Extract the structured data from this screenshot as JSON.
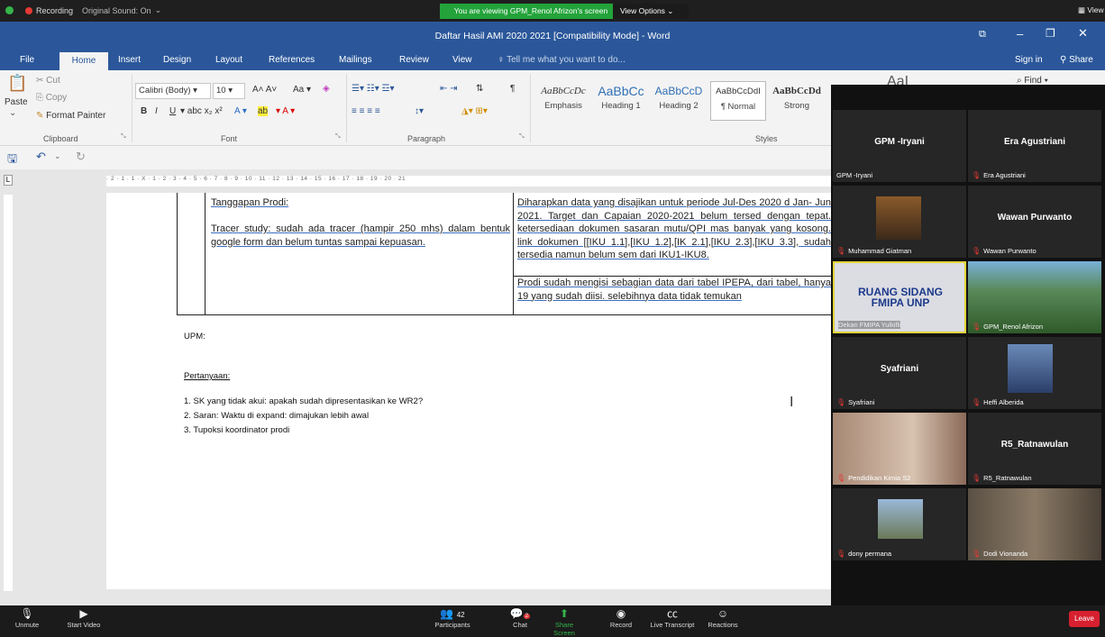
{
  "zoom": {
    "recording": "Recording",
    "original_sound": "Original Sound: On",
    "viewing_banner": "You are viewing GPM_Renol Afrizon's screen",
    "view_options": "View Options",
    "top_right_view": "View",
    "toolbar": {
      "unmute": "Unmute",
      "start_video": "Start Video",
      "participants_count": "42",
      "participants": "Participants",
      "chat": "Chat",
      "chat_badge": "2",
      "share_screen": "Share Screen",
      "record": "Record",
      "live_transcript": "Live Transcript",
      "reactions": "Reactions",
      "leave": "Leave"
    }
  },
  "word": {
    "title": "Daftar Hasil AMI 2020 2021 [Compatibility Mode] - Word",
    "menu": [
      "File",
      "Home",
      "Insert",
      "Design",
      "Layout",
      "References",
      "Mailings",
      "Review",
      "View"
    ],
    "tell_me": "Tell me what you want to do...",
    "sign_in": "Sign in",
    "share": "Share",
    "clipboard": {
      "paste": "Paste",
      "cut": "Cut",
      "copy": "Copy",
      "format_painter": "Format Painter",
      "label": "Clipboard"
    },
    "font": {
      "name": "Calibri (Body)",
      "size": "10",
      "label": "Font"
    },
    "paragraph_label": "Paragraph",
    "styles": {
      "label": "Styles",
      "items": [
        {
          "sample": "AaBbCcDc",
          "name": "Emphasis"
        },
        {
          "sample": "AaBbCc",
          "name": "Heading 1"
        },
        {
          "sample": "AaBbCcD",
          "name": "Heading 2"
        },
        {
          "sample": "AaBbCcDdI",
          "name": "¶ Normal"
        },
        {
          "sample": "AaBbCcDd",
          "name": "Strong"
        }
      ],
      "partial_sample": "AaI"
    },
    "find": "Find",
    "ruler_text": "· 2 · 1 · 1 · X · 1 · 2 · 3 · 4 · 5 · 6 · 7 · 8 · 9 · 10 · 11 · 12 · 13 · 14 · 15 · 16 · 17 · 18 · 19 · 20 · 21"
  },
  "document": {
    "left_cell": {
      "heading": "Tanggapan Prodi:",
      "body": "Tracer study: sudah ada tracer  (hampir 250 mhs) dalam bentuk google form dan  belum tuntas sampai kepuasan."
    },
    "right_cell_1": "Diharapkan data yang disajikan untuk periode Jul-Des 2020 d Jan- Jun 2021. Target dan Capaian 2020-2021 belum tersed dengan tepat. ketersediaan dokumen sasaran mutu/QPI mas banyak yang kosong. link dokumen [[IKU 1.1],[IKU 1.2],[IK 2.1],[IKU 2.3],[IKU 3.3], sudah tersedia namun belum sem dari IKU1-IKU8.",
    "right_cell_2": "Prodi sudah mengisi sebagian data dari tabel IPEPA, dari tabel, hanya 19 yang sudah diisi. selebihnya data tidak temukan",
    "upm": "UPM:",
    "pertanyaan": "Pertanyaan:",
    "items": [
      "1. SK yang tidak akui: apakah sudah dipresentasikan ke WR2?",
      "2. Saran: Waktu di expand: dimajukan lebih awal",
      "3. Tupoksi koordinator prodi"
    ]
  },
  "participants": [
    {
      "big": "GPM -Iryani",
      "name": "GPM -Iryani",
      "muted": false,
      "kind": "name"
    },
    {
      "big": "Era Agustriani",
      "name": "Era Agustriani",
      "muted": true,
      "kind": "name"
    },
    {
      "big": "",
      "name": "Muhammad Giatman",
      "muted": true,
      "kind": "photo"
    },
    {
      "big": "Wawan Purwanto",
      "name": "Wawan Purwanto",
      "muted": true,
      "kind": "name"
    },
    {
      "big": "",
      "name": "Dekan FMIPA Yulkifli",
      "muted": false,
      "kind": "room",
      "room_text": "RUANG SIDANG FMIPA UNP"
    },
    {
      "big": "",
      "name": "GPM_Renol Afrizon",
      "muted": true,
      "kind": "landscape"
    },
    {
      "big": "Syafriani",
      "name": "Syafriani",
      "muted": true,
      "kind": "name"
    },
    {
      "big": "",
      "name": "Heffi Alberida",
      "muted": true,
      "kind": "photo"
    },
    {
      "big": "",
      "name": "Pendidikan Kimia S2",
      "muted": true,
      "kind": "room2"
    },
    {
      "big": "R5_Ratnawulan",
      "name": "R5_Ratnawulan",
      "muted": true,
      "kind": "name"
    },
    {
      "big": "",
      "name": "dony permana",
      "muted": true,
      "kind": "mountain"
    },
    {
      "big": "",
      "name": "Dodi Vionanda",
      "muted": true,
      "kind": "face"
    }
  ],
  "colors": {
    "word_blue": "#2b579a",
    "zoom_green": "#23a33a",
    "mute_red": "#e53935",
    "leave_red": "#d6202f"
  }
}
